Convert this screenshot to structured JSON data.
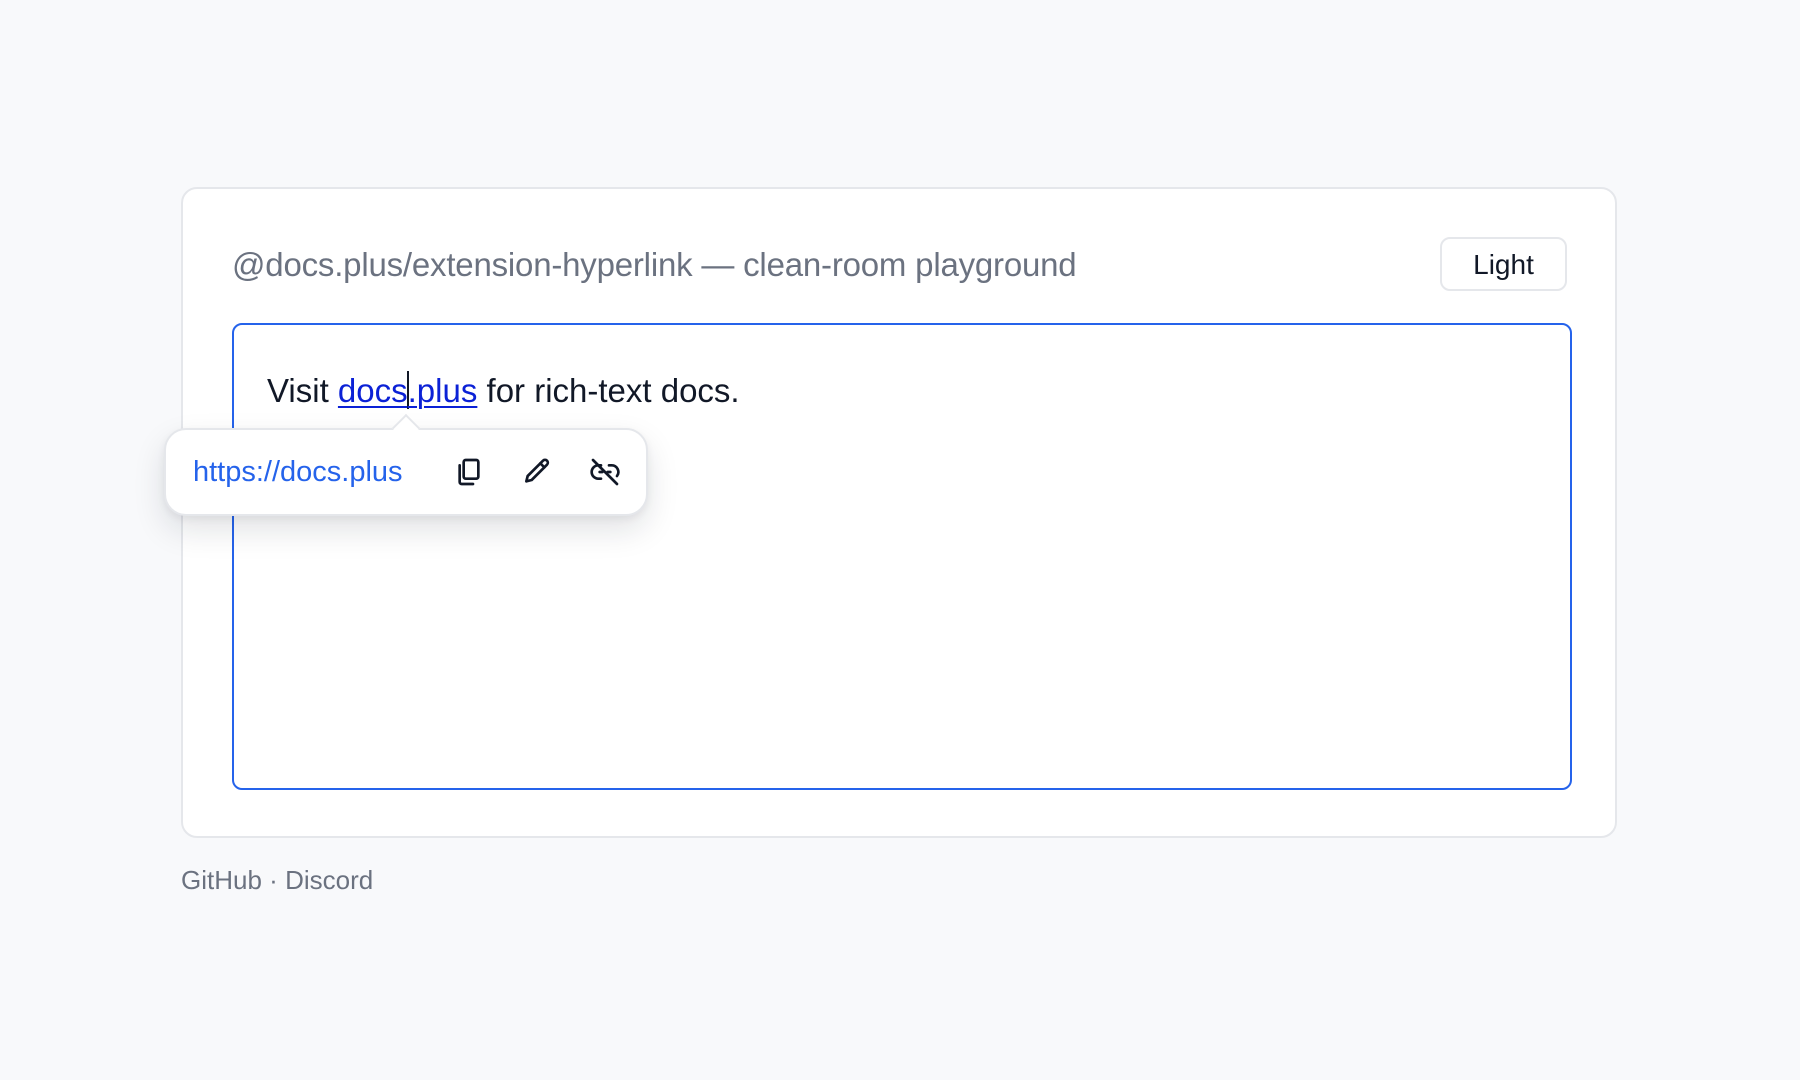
{
  "header": {
    "title": "@docs.plus/extension-hyperlink — clean-room playground",
    "theme_button_label": "Light"
  },
  "editor": {
    "text_before": "Visit ",
    "link_text_part1": "docs",
    "link_text_part2": ".plus",
    "text_after": " for rich-text docs."
  },
  "link_popover": {
    "url": "https://docs.plus",
    "actions": [
      {
        "name": "copy",
        "icon": "copy-icon"
      },
      {
        "name": "edit",
        "icon": "pencil-icon"
      },
      {
        "name": "unlink",
        "icon": "unlink-icon"
      }
    ]
  },
  "footer": {
    "github_label": "GitHub",
    "separator": "·",
    "discord_label": "Discord"
  },
  "colors": {
    "accent": "#2563eb",
    "link": "#0b21d6",
    "muted_text": "#6b7280",
    "page_background": "#f8f9fb"
  }
}
